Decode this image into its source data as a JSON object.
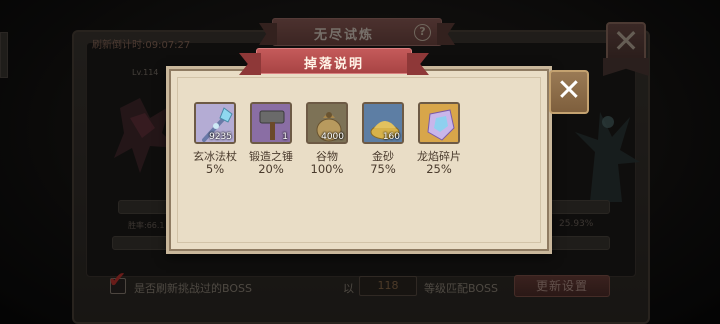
{
  "background": {
    "title": "无尽试炼",
    "timer_text": "刷新倒计时:09:07:27",
    "level_text": "Lv.114",
    "rate_text": "胜率:66.1",
    "percent_text": "25.93%",
    "refresh_checkbox_label": "是否刷新挑战过的BOSS",
    "refresh_checked": true,
    "yi_label": "以",
    "level_value": "118",
    "match_label": "等级匹配BOSS",
    "update_button_label": "更新设置",
    "close_label": "✕"
  },
  "popup": {
    "title": "掉落说明",
    "close_label": "✕",
    "items": [
      {
        "icon": "ice-staff-icon",
        "name": "玄冰法杖",
        "count": "9235",
        "rate": "5%",
        "slot_color": "#a9a0c9"
      },
      {
        "icon": "forge-hammer-icon",
        "name": "锻造之锤",
        "count": "1",
        "rate": "20%",
        "slot_color": "#8b6fa6"
      },
      {
        "icon": "grain-sack-icon",
        "name": "谷物",
        "count": "4000",
        "rate": "100%",
        "slot_color": "#7a6f55"
      },
      {
        "icon": "gold-sand-icon",
        "name": "金砂",
        "count": "160",
        "rate": "75%",
        "slot_color": "#5e7fa6"
      },
      {
        "icon": "dragon-flame-shard-icon",
        "name": "龙焰碎片",
        "count": "",
        "rate": "25%",
        "slot_color": "#d9a84a"
      }
    ]
  }
}
